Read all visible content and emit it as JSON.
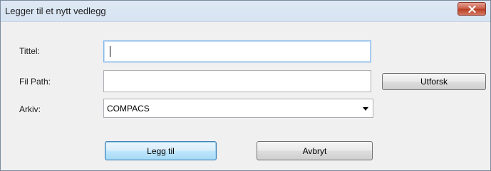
{
  "window": {
    "title": "Legger til et nytt vedlegg",
    "close_icon": "close-x-icon",
    "accent_close": "#c85c45"
  },
  "form": {
    "title_label": "Tittel:",
    "title_value": "",
    "path_label": "Fil Path:",
    "path_value": "",
    "browse_label": "Utforsk",
    "archive_label": "Arkiv:",
    "archive_selected": "COMPACS"
  },
  "actions": {
    "add_label": "Legg til",
    "cancel_label": "Avbryt"
  }
}
